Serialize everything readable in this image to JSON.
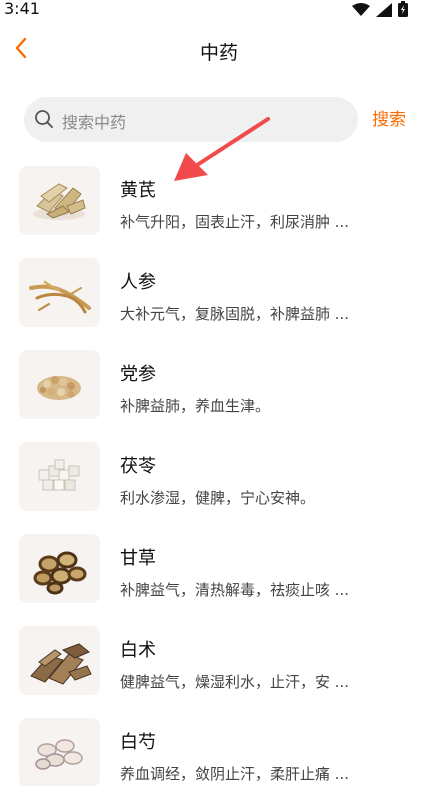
{
  "status_bar": {
    "time": "3:41"
  },
  "header": {
    "title": "中药"
  },
  "search": {
    "placeholder": "搜索中药",
    "button_label": "搜索"
  },
  "herbs": [
    {
      "name": "黄芪",
      "desc": "补气升阳，固表止汗，利尿消肿 ..."
    },
    {
      "name": "人参",
      "desc": "大补元气，复脉固脱，补脾益肺 ..."
    },
    {
      "name": "党参",
      "desc": "补脾益肺，养血生津。"
    },
    {
      "name": "茯苓",
      "desc": "利水渗湿，健脾，宁心安神。"
    },
    {
      "name": "甘草",
      "desc": "补脾益气，清热解毒，祛痰止咳 ..."
    },
    {
      "name": "白术",
      "desc": "健脾益气，燥湿利水，止汗，安 ..."
    },
    {
      "name": "白芍",
      "desc": "养血调经，敛阴止汗，柔肝止痛 ..."
    }
  ],
  "colors": {
    "accent": "#ff6a00",
    "arrow": "#f04a4a",
    "search_bg": "#f0f0f0"
  }
}
